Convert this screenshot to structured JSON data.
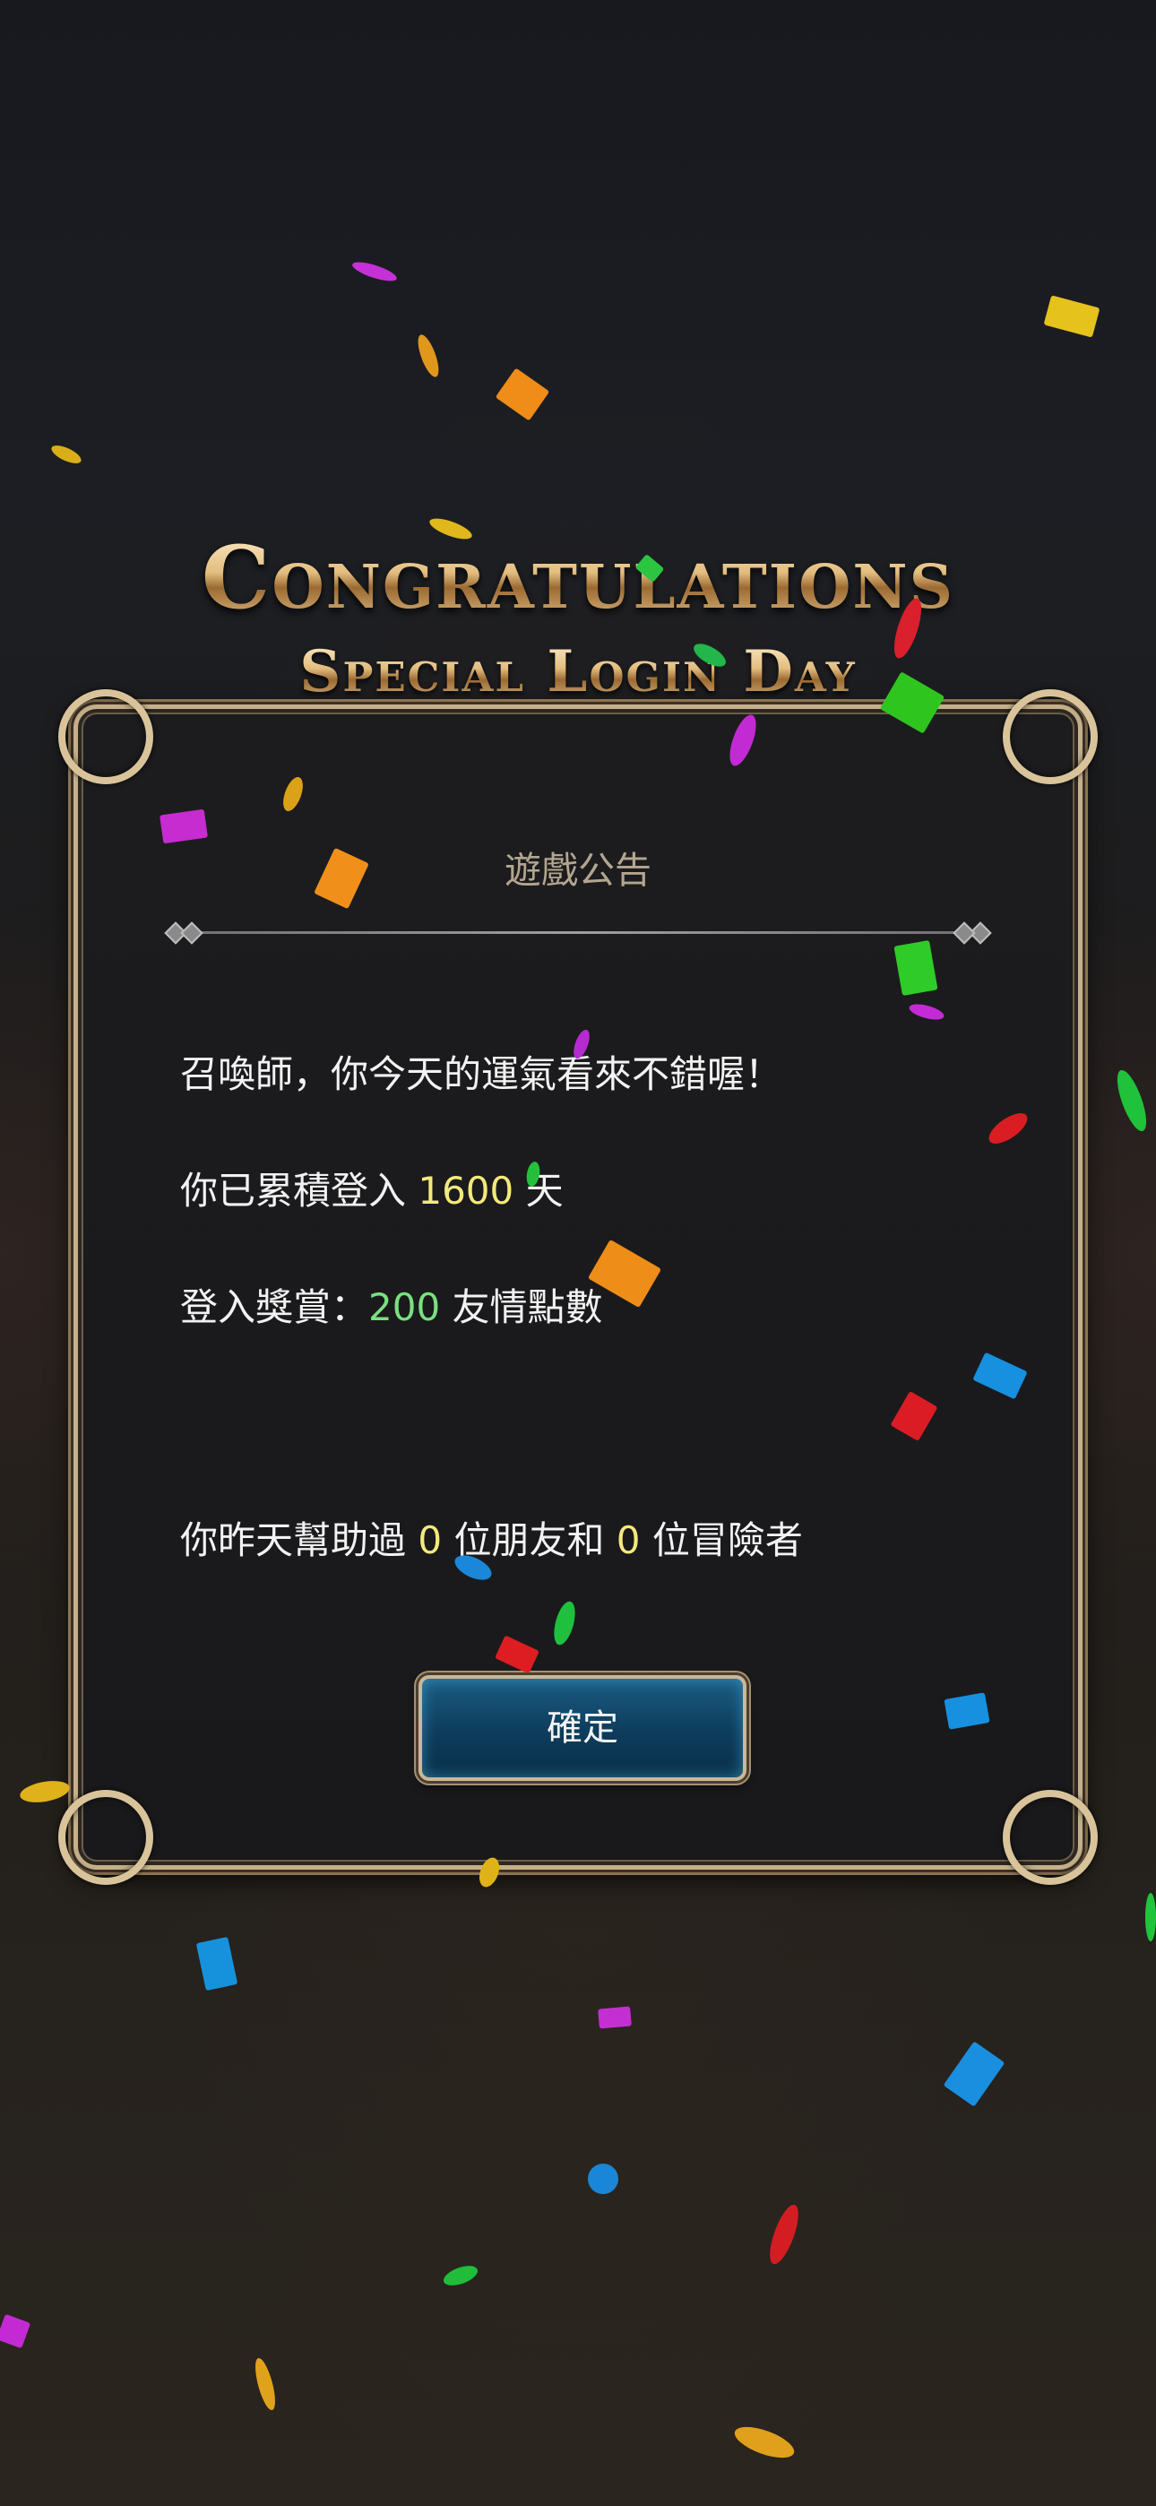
{
  "banner": {
    "title": "Congratulations",
    "subtitle": "Special Login Day"
  },
  "dialog": {
    "title": "遊戲公告",
    "greeting": "召喚師，你今天的運氣看來不錯喔！",
    "login_prefix": "你已累積登入 ",
    "login_days": "1600",
    "login_suffix": " 天",
    "reward_prefix": "登入獎賞：",
    "reward_amount": "200",
    "reward_suffix": " 友情點數",
    "help_prefix": "你昨天幫助過 ",
    "friends_count": "0",
    "help_mid": " 位朋友和 ",
    "adventurers_count": "0",
    "help_suffix": " 位冒險者",
    "confirm_label": "確定"
  },
  "colors": {
    "highlight_yellow": "#f4e97c",
    "highlight_green": "#79e07f",
    "gold_frame": "#c6b08a",
    "button_blue": "#0d3c5c"
  }
}
